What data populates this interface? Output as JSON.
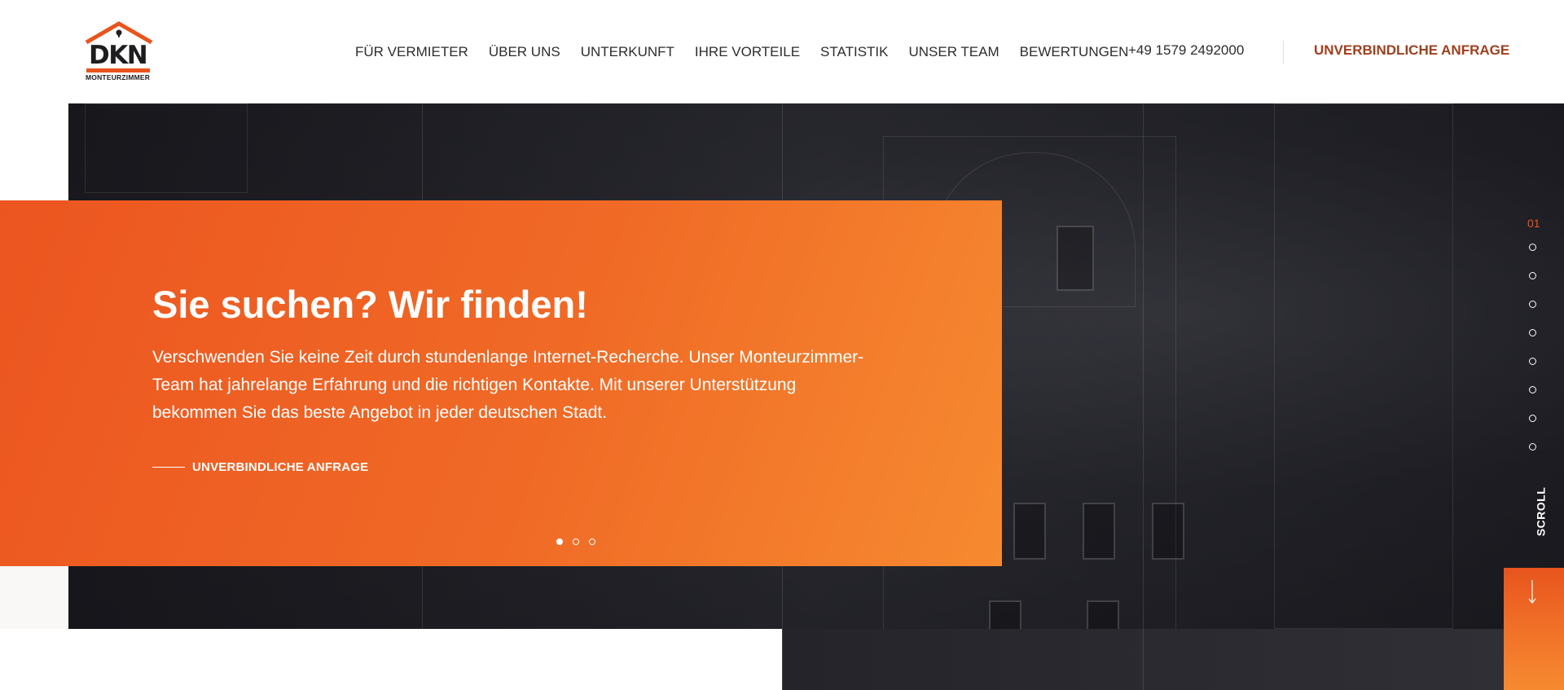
{
  "logo": {
    "title": "DKN",
    "subtitle": "MONTEURZIMMER"
  },
  "nav": {
    "items": [
      {
        "label": "FÜR VERMIETER"
      },
      {
        "label": "ÜBER UNS"
      },
      {
        "label": "UNTERKUNFT"
      },
      {
        "label": "IHRE VORTEILE"
      },
      {
        "label": "STATISTIK"
      },
      {
        "label": "UNSER TEAM"
      },
      {
        "label": "BEWERTUNGEN"
      }
    ],
    "phone": "+49 1579 2492000",
    "cta": "UNVERBINDLICHE ANFRAGE"
  },
  "hero": {
    "title": "Sie suchen? Wir finden!",
    "text": "Verschwenden Sie keine Zeit durch stundenlange Internet-Recherche. Unser Monteurzimmer-Team hat jahrelange Erfahrung und die richtigen Kontakte. Mit unserer Unterstützung bekommen Sie das beste Angebot in jeder deutschen Stadt.",
    "cta": "UNVERBINDLICHE ANFRAGE",
    "slider_dots": 3,
    "active_slider_dot": 1
  },
  "side_nav": {
    "current": "01",
    "dot_count": 8,
    "scroll_label": "SCROLL"
  },
  "colors": {
    "accent": "#e8541d",
    "cta_text": "#a03f1e",
    "panel_start": "#ec5520",
    "panel_end": "#f68a30"
  }
}
